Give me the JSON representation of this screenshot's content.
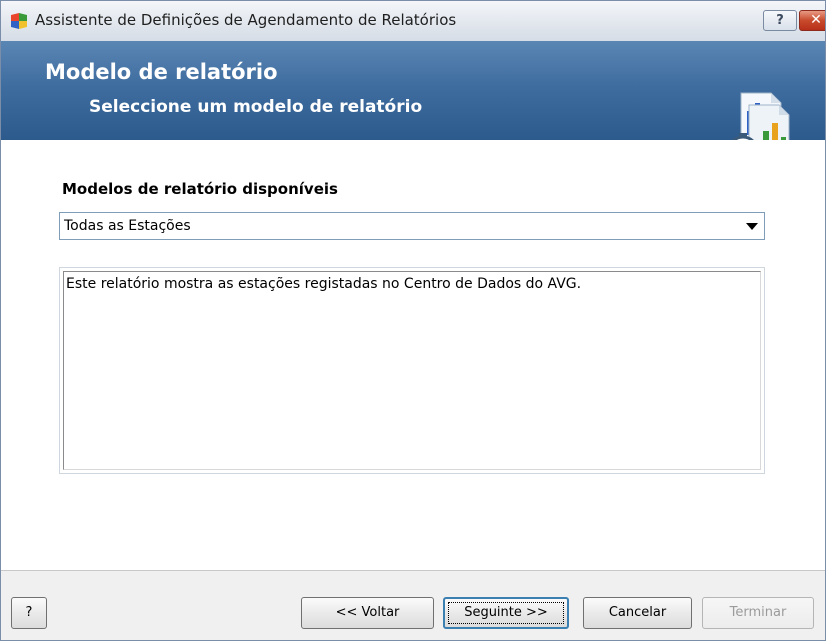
{
  "window": {
    "title": "Assistente de Definições de Agendamento de Relatórios",
    "help_button": "?",
    "close_button": "✕"
  },
  "header": {
    "title": "Modelo de relatório",
    "subtitle": "Seleccione um modelo de relatório"
  },
  "main": {
    "label": "Modelos de relatório disponíveis",
    "template_select": {
      "selected": "Todas as Estações"
    },
    "description": "Este relatório mostra as estações registadas no Centro de Dados do AVG."
  },
  "footer": {
    "help_label": "?",
    "back_label": "<< Voltar",
    "next_label": "Seguinte >>",
    "cancel_label": "Cancelar",
    "finish_label": "Terminar",
    "finish_enabled": false
  },
  "colors": {
    "banner": "#3f6d9f",
    "close": "#c84a2c"
  }
}
